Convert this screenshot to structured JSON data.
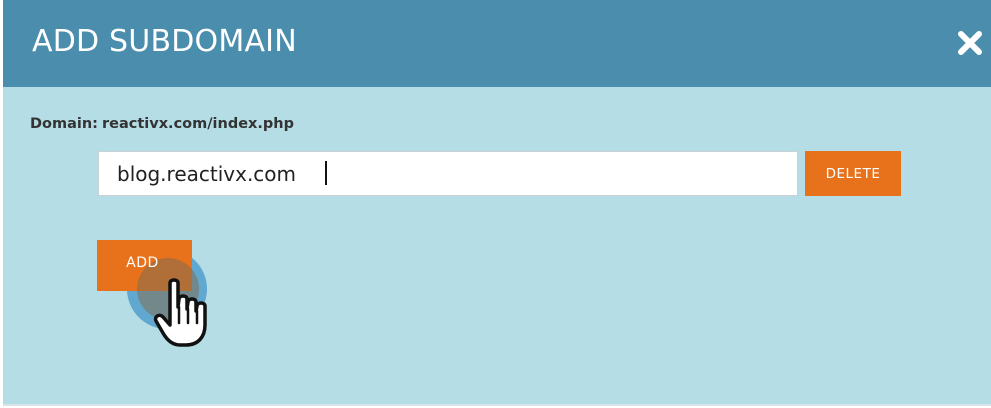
{
  "dialog": {
    "title": "ADD SUBDOMAIN",
    "close_icon": "close-icon",
    "domain_label": "Domain:",
    "domain_value": "reactivx.com/index.php"
  },
  "subdomain_row": {
    "input_value": "blog.reactivx.com",
    "delete_label": "DELETE"
  },
  "add_label": "ADD",
  "cursor_icon": "hand-cursor-icon",
  "colors": {
    "header_bg": "#4b8dad",
    "body_bg": "#b5dde6",
    "accent_button": "#e8711b",
    "text_dark": "#333333"
  }
}
